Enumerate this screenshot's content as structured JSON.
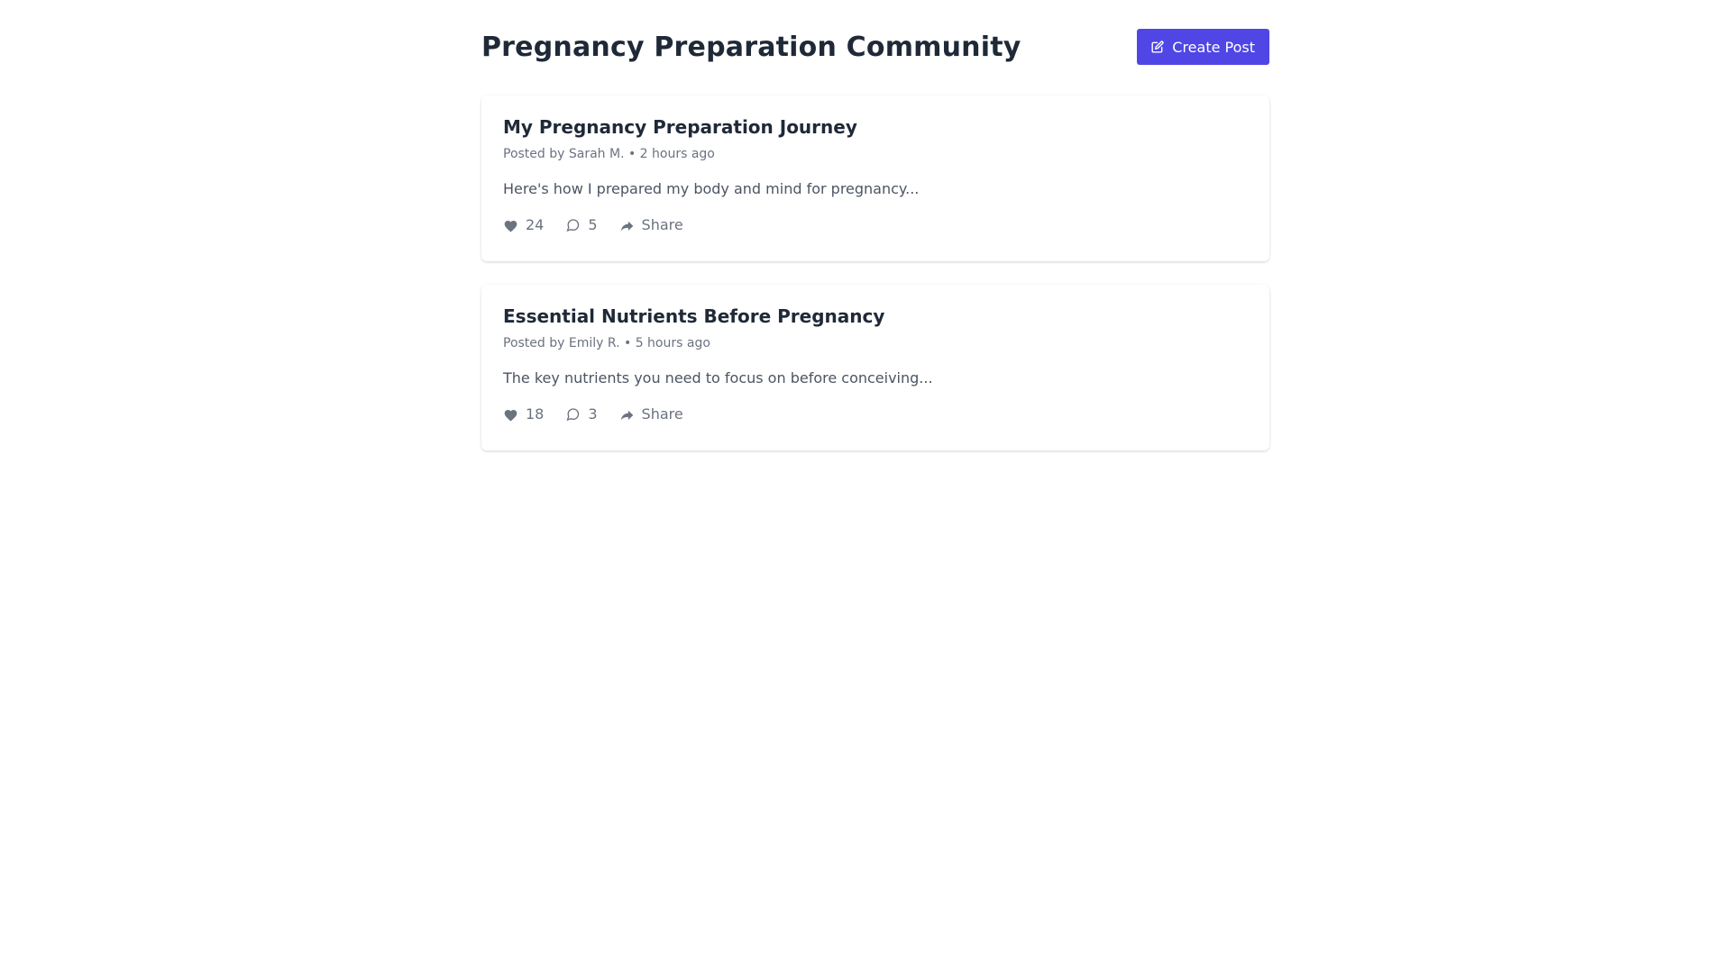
{
  "header": {
    "title": "Pregnancy Preparation Community",
    "create_post_label": "Create Post",
    "create_post_icon": "edit-icon"
  },
  "colors": {
    "accent": "#4f46e5",
    "title_text": "#1f2937",
    "meta_text": "#6b7280",
    "excerpt_text": "#4b5563"
  },
  "posts": [
    {
      "title": "My Pregnancy Preparation Journey",
      "meta": "Posted by Sarah M. • 2 hours ago",
      "excerpt": "Here's how I prepared my body and mind for pregnancy...",
      "likes": "24",
      "comments": "5",
      "share_label": "Share"
    },
    {
      "title": "Essential Nutrients Before Pregnancy",
      "meta": "Posted by Emily R. • 5 hours ago",
      "excerpt": "The key nutrients you need to focus on before conceiving...",
      "likes": "18",
      "comments": "3",
      "share_label": "Share"
    }
  ],
  "icons": {
    "like": "heart-icon",
    "comment": "comment-icon",
    "share": "share-icon"
  }
}
